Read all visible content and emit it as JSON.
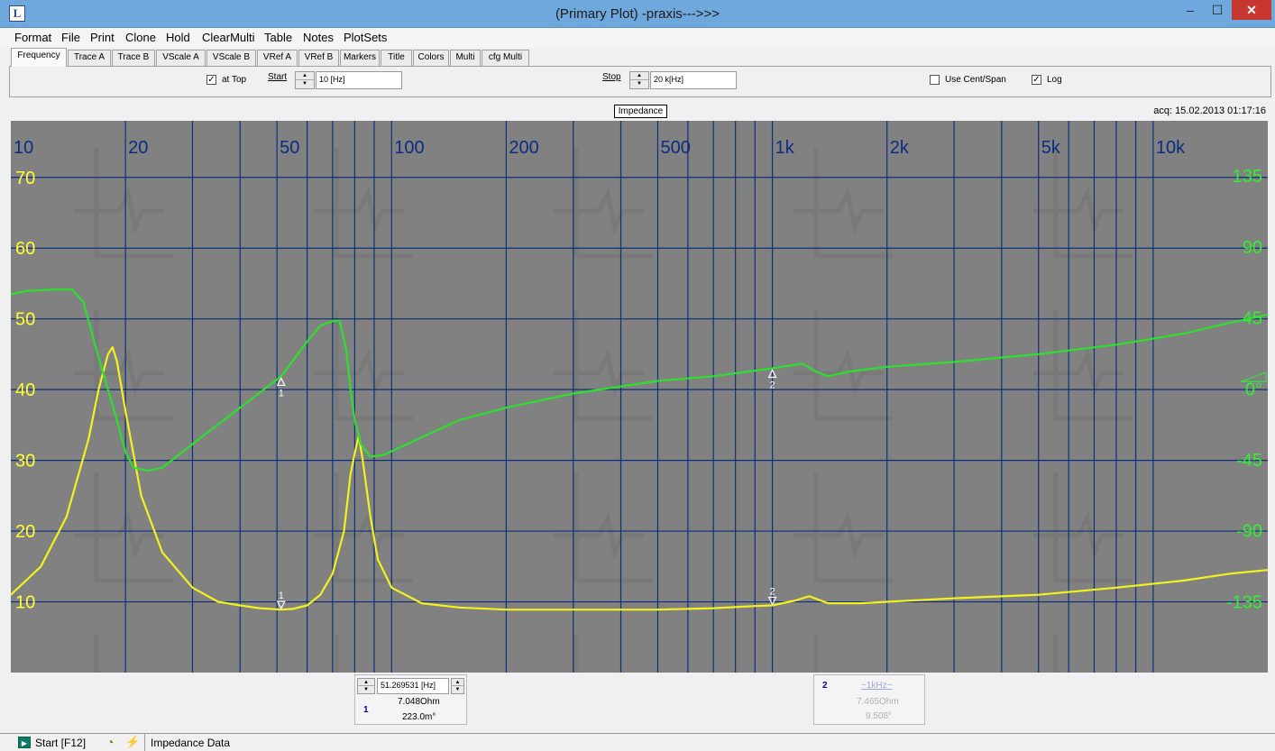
{
  "window": {
    "title": "(Primary Plot) -praxis--->>>",
    "app_icon_glyph": "L",
    "minimize": "–",
    "maximize": "☐",
    "close": "✕"
  },
  "menu": [
    "Format",
    "File",
    "Print",
    "Clone",
    "Hold",
    "ClearMulti",
    "Table",
    "Notes",
    "PlotSets"
  ],
  "tabs": [
    "Frequency",
    "Trace A",
    "Trace B",
    "VScale A",
    "VScale B",
    "VRef A",
    "VRef B",
    "Markers",
    "Title",
    "Colors",
    "Multi",
    "cfg Multi"
  ],
  "frequency_panel": {
    "at_top_checked": "✓",
    "at_top_label": "at Top",
    "start_label": "Start",
    "start_value": "10 [Hz]",
    "stop_label": "Stop",
    "stop_value": "20 k[Hz]",
    "cent_span_checked": "",
    "cent_span_label": "Use Cent/Span",
    "log_checked": "✓",
    "log_label": "Log",
    "spin_up": "▲",
    "spin_down": "▼"
  },
  "plot_info": {
    "title": "Impedance",
    "acq": "acq: 15.02.2013 01:17:16"
  },
  "chart_data": {
    "type": "line",
    "title": "Impedance",
    "x_scale": "log",
    "x_range": [
      10,
      20000
    ],
    "x_tick_labels": [
      {
        "value": 10,
        "label": "10"
      },
      {
        "value": 20,
        "label": "20"
      },
      {
        "value": 50,
        "label": "50"
      },
      {
        "value": 100,
        "label": "100"
      },
      {
        "value": 200,
        "label": "200"
      },
      {
        "value": 500,
        "label": "500"
      },
      {
        "value": 1000,
        "label": "1k"
      },
      {
        "value": 2000,
        "label": "2k"
      },
      {
        "value": 5000,
        "label": "5k"
      },
      {
        "value": 10000,
        "label": "10k"
      }
    ],
    "y_left": {
      "range": [
        0,
        78
      ],
      "ticks": [
        10,
        20,
        30,
        40,
        50,
        60,
        70
      ],
      "color": "#ffff33"
    },
    "y_right": {
      "range": [
        -180,
        170
      ],
      "ticks": [
        -135,
        -90,
        -45,
        0,
        45,
        90,
        135
      ],
      "tick_labels": [
        "-135",
        "-90",
        "-45",
        "0°",
        "45",
        "90",
        "135"
      ],
      "color": "#33ee33"
    },
    "grid": true,
    "series": [
      {
        "axis": "left",
        "color": "#f2f21e",
        "points": [
          [
            10,
            11
          ],
          [
            12,
            15
          ],
          [
            14,
            22
          ],
          [
            16,
            33
          ],
          [
            17,
            40
          ],
          [
            18,
            45
          ],
          [
            18.5,
            46
          ],
          [
            19,
            44
          ],
          [
            20,
            37
          ],
          [
            22,
            25
          ],
          [
            25,
            17
          ],
          [
            30,
            12
          ],
          [
            35,
            10
          ],
          [
            40,
            9.5
          ],
          [
            45,
            9.1
          ],
          [
            51.3,
            8.9
          ],
          [
            55,
            9
          ],
          [
            60,
            9.5
          ],
          [
            65,
            11
          ],
          [
            70,
            14
          ],
          [
            75,
            20
          ],
          [
            78,
            28
          ],
          [
            80,
            31
          ],
          [
            82,
            33.5
          ],
          [
            84,
            30
          ],
          [
            88,
            22
          ],
          [
            92,
            16
          ],
          [
            100,
            12
          ],
          [
            120,
            9.8
          ],
          [
            150,
            9.2
          ],
          [
            200,
            8.9
          ],
          [
            300,
            8.9
          ],
          [
            500,
            8.9
          ],
          [
            700,
            9.1
          ],
          [
            900,
            9.4
          ],
          [
            1000,
            9.5
          ],
          [
            1150,
            10.2
          ],
          [
            1250,
            10.8
          ],
          [
            1400,
            9.8
          ],
          [
            1700,
            9.8
          ],
          [
            2000,
            10
          ],
          [
            3000,
            10.5
          ],
          [
            5000,
            11
          ],
          [
            8000,
            12
          ],
          [
            12000,
            13
          ],
          [
            16000,
            14
          ],
          [
            20000,
            14.5
          ]
        ]
      },
      {
        "axis": "right",
        "color": "#2de02d",
        "points": [
          [
            10,
            60
          ],
          [
            11,
            62
          ],
          [
            13,
            63
          ],
          [
            14.5,
            63
          ],
          [
            15.5,
            55
          ],
          [
            17,
            20
          ],
          [
            19,
            -20
          ],
          [
            20,
            -40
          ],
          [
            21,
            -50
          ],
          [
            23,
            -52
          ],
          [
            25,
            -50
          ],
          [
            30,
            -35
          ],
          [
            40,
            -12
          ],
          [
            51.3,
            8
          ],
          [
            60,
            30
          ],
          [
            65,
            40
          ],
          [
            70,
            43
          ],
          [
            73,
            43
          ],
          [
            76,
            25
          ],
          [
            78,
            0
          ],
          [
            80,
            -20
          ],
          [
            83,
            -35
          ],
          [
            88,
            -43
          ],
          [
            95,
            -42
          ],
          [
            110,
            -35
          ],
          [
            150,
            -20
          ],
          [
            200,
            -12
          ],
          [
            300,
            -3
          ],
          [
            500,
            5
          ],
          [
            700,
            8
          ],
          [
            1000,
            13
          ],
          [
            1200,
            16
          ],
          [
            1300,
            11
          ],
          [
            1400,
            8
          ],
          [
            1600,
            11
          ],
          [
            2000,
            14
          ],
          [
            3000,
            17
          ],
          [
            5000,
            22
          ],
          [
            8000,
            28
          ],
          [
            12000,
            35
          ],
          [
            16000,
            42
          ],
          [
            20000,
            47
          ]
        ]
      }
    ],
    "markers": [
      {
        "label": "1",
        "freq": 51.2695
      },
      {
        "label": "2",
        "freq": 1000
      }
    ]
  },
  "readouts": {
    "m1": {
      "freq": "51.269531 [Hz]",
      "mag": "7.048Ohm",
      "phase": "223.0m°",
      "index": "1"
    },
    "m2": {
      "index": "2",
      "freq": "~1kHz~",
      "mag": "7.465Ohm",
      "phase": "9.508°"
    }
  },
  "status": {
    "start_label": "Start [F12]",
    "data_label": "Impedance Data",
    "play_icon": "▶",
    "clock_icon": "◔",
    "probe_icon": "⚡"
  }
}
